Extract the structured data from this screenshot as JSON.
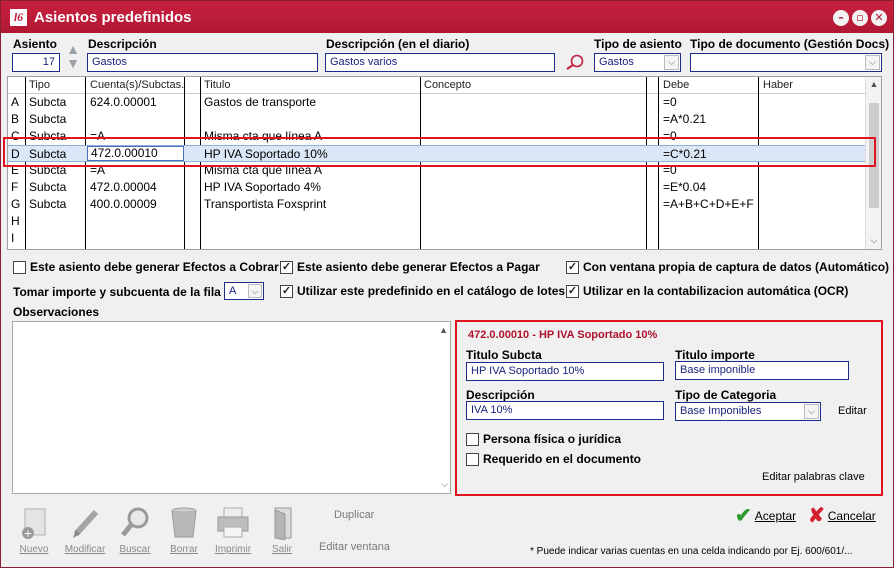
{
  "window": {
    "title": "Asientos predefinidos",
    "logo": "l6"
  },
  "header": {
    "asiento_label": "Asiento",
    "asiento_value": "17",
    "descripcion_label": "Descripción",
    "descripcion_value": "Gastos",
    "desc_diario_label": "Descripción (en el diario)",
    "desc_diario_value": "Gastos varios",
    "tipo_asiento_label": "Tipo de asiento",
    "tipo_asiento_value": "Gastos",
    "tipo_doc_label": "Tipo de documento (Gestión Docs)",
    "tipo_doc_value": ""
  },
  "grid": {
    "columns": [
      "Tipo",
      "Cuenta(s)/Subctas.",
      "Titulo",
      "Concepto",
      "Debe",
      "Haber"
    ],
    "rows": [
      {
        "letter": "A",
        "tipo": "Subcta",
        "cuenta": "624.0.00001",
        "titulo": "Gastos de transporte",
        "concepto": "",
        "debe": "=0",
        "haber": ""
      },
      {
        "letter": "B",
        "tipo": "Subcta",
        "cuenta": "",
        "titulo": "",
        "concepto": "",
        "debe": "=A*0.21",
        "haber": ""
      },
      {
        "letter": "C",
        "tipo": "Subcta",
        "cuenta": "=A",
        "titulo": "Misma cta que línea A",
        "concepto": "",
        "debe": "=0",
        "haber": ""
      },
      {
        "letter": "D",
        "tipo": "Subcta",
        "cuenta": "472.0.00010",
        "titulo": "HP IVA Soportado 10%",
        "concepto": "",
        "debe": "=C*0.21",
        "haber": ""
      },
      {
        "letter": "E",
        "tipo": "Subcta",
        "cuenta": "=A",
        "titulo": "Misma cta que línea A",
        "concepto": "",
        "debe": "=0",
        "haber": ""
      },
      {
        "letter": "F",
        "tipo": "Subcta",
        "cuenta": "472.0.00004",
        "titulo": "HP IVA Soportado 4%",
        "concepto": "",
        "debe": "=E*0.04",
        "haber": ""
      },
      {
        "letter": "G",
        "tipo": "Subcta",
        "cuenta": "400.0.00009",
        "titulo": "Transportista Foxsprint",
        "concepto": "",
        "debe": "=A+B+C+D+E+F",
        "haber": ""
      },
      {
        "letter": "H",
        "tipo": "",
        "cuenta": "",
        "titulo": "",
        "concepto": "",
        "debe": "",
        "haber": ""
      },
      {
        "letter": "I",
        "tipo": "",
        "cuenta": "",
        "titulo": "",
        "concepto": "",
        "debe": "",
        "haber": ""
      }
    ]
  },
  "options": {
    "efectos_cobrar": "Este asiento debe generar Efectos a Cobrar",
    "efectos_pagar": "Este asiento debe generar Efectos a Pagar",
    "ventana_propia": "Con ventana propia de captura de datos (Automático)",
    "tomar_importe": "Tomar importe y subcuenta de la fila",
    "tomar_importe_value": "A",
    "catalogo_lotes": "Utilizar este predefinido en el catálogo de lotes",
    "ocr": "Utilizar en la contabilizacion automática (OCR)"
  },
  "observaciones_label": "Observaciones",
  "detail": {
    "title": "472.0.00010 - HP IVA Soportado 10%",
    "titulo_subcta_label": "Titulo Subcta",
    "titulo_subcta_value": "HP IVA Soportado 10%",
    "titulo_importe_label": "Titulo importe",
    "titulo_importe_value": "Base imponible",
    "descripcion_label": "Descripción",
    "descripcion_value": "IVA 10%",
    "tipo_categoria_label": "Tipo de Categoria",
    "tipo_categoria_value": "Base Imponibles",
    "editar": "Editar",
    "persona": "Persona física o jurídica",
    "requerido": "Requerido en el documento",
    "editar_palabras": "Editar palabras clave"
  },
  "toolbar": {
    "nuevo": "Nuevo",
    "modificar": "Modificar",
    "buscar": "Buscar",
    "borrar": "Borrar",
    "imprimir": "Imprimir",
    "salir": "Salir",
    "duplicar": "Duplicar",
    "editar_ventana": "Editar ventana"
  },
  "actions": {
    "aceptar": "Aceptar",
    "cancelar": "Cancelar"
  },
  "footnote": "* Puede indicar varias cuentas en una celda indicando por Ej. 600/601/...",
  "colors": {
    "titlebar": "#c01e3a",
    "highlight": "#e0141e",
    "field_border": "#1a2d8c"
  },
  "icons": [
    "app-logo",
    "minimize-icon",
    "maximize-icon",
    "close-icon",
    "search-icon",
    "new-icon",
    "edit-icon",
    "magnifier-icon",
    "trash-icon",
    "printer-icon",
    "exit-icon",
    "accept-check-icon",
    "cancel-x-icon"
  ]
}
